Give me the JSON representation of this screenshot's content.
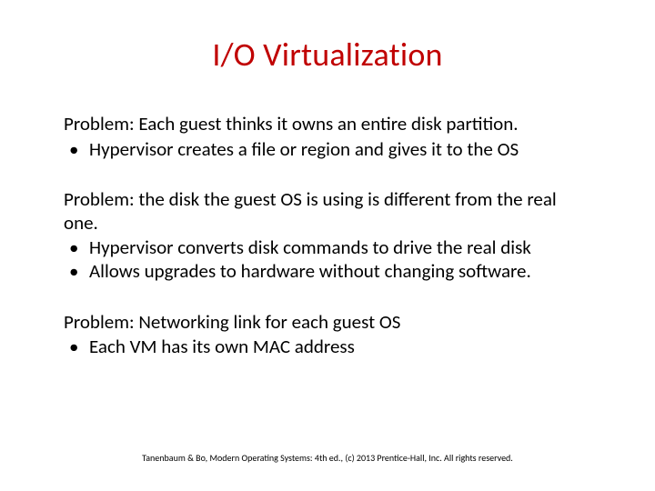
{
  "title": "I/O Virtualization",
  "blocks": [
    {
      "lead": "Problem: Each guest thinks it owns an entire disk partition.",
      "bullets": [
        "Hypervisor creates a file or region and gives it to the OS"
      ]
    },
    {
      "lead": "Problem: the disk the guest OS is using is different from the real one.",
      "bullets": [
        "Hypervisor converts disk commands to drive the real disk",
        "Allows upgrades to hardware without changing software."
      ]
    },
    {
      "lead": "Problem: Networking link for each guest OS",
      "bullets": [
        "Each VM has its own MAC address"
      ]
    }
  ],
  "footer": "Tanenbaum & Bo, Modern Operating Systems: 4th ed., (c) 2013 Prentice-Hall, Inc. All rights reserved."
}
